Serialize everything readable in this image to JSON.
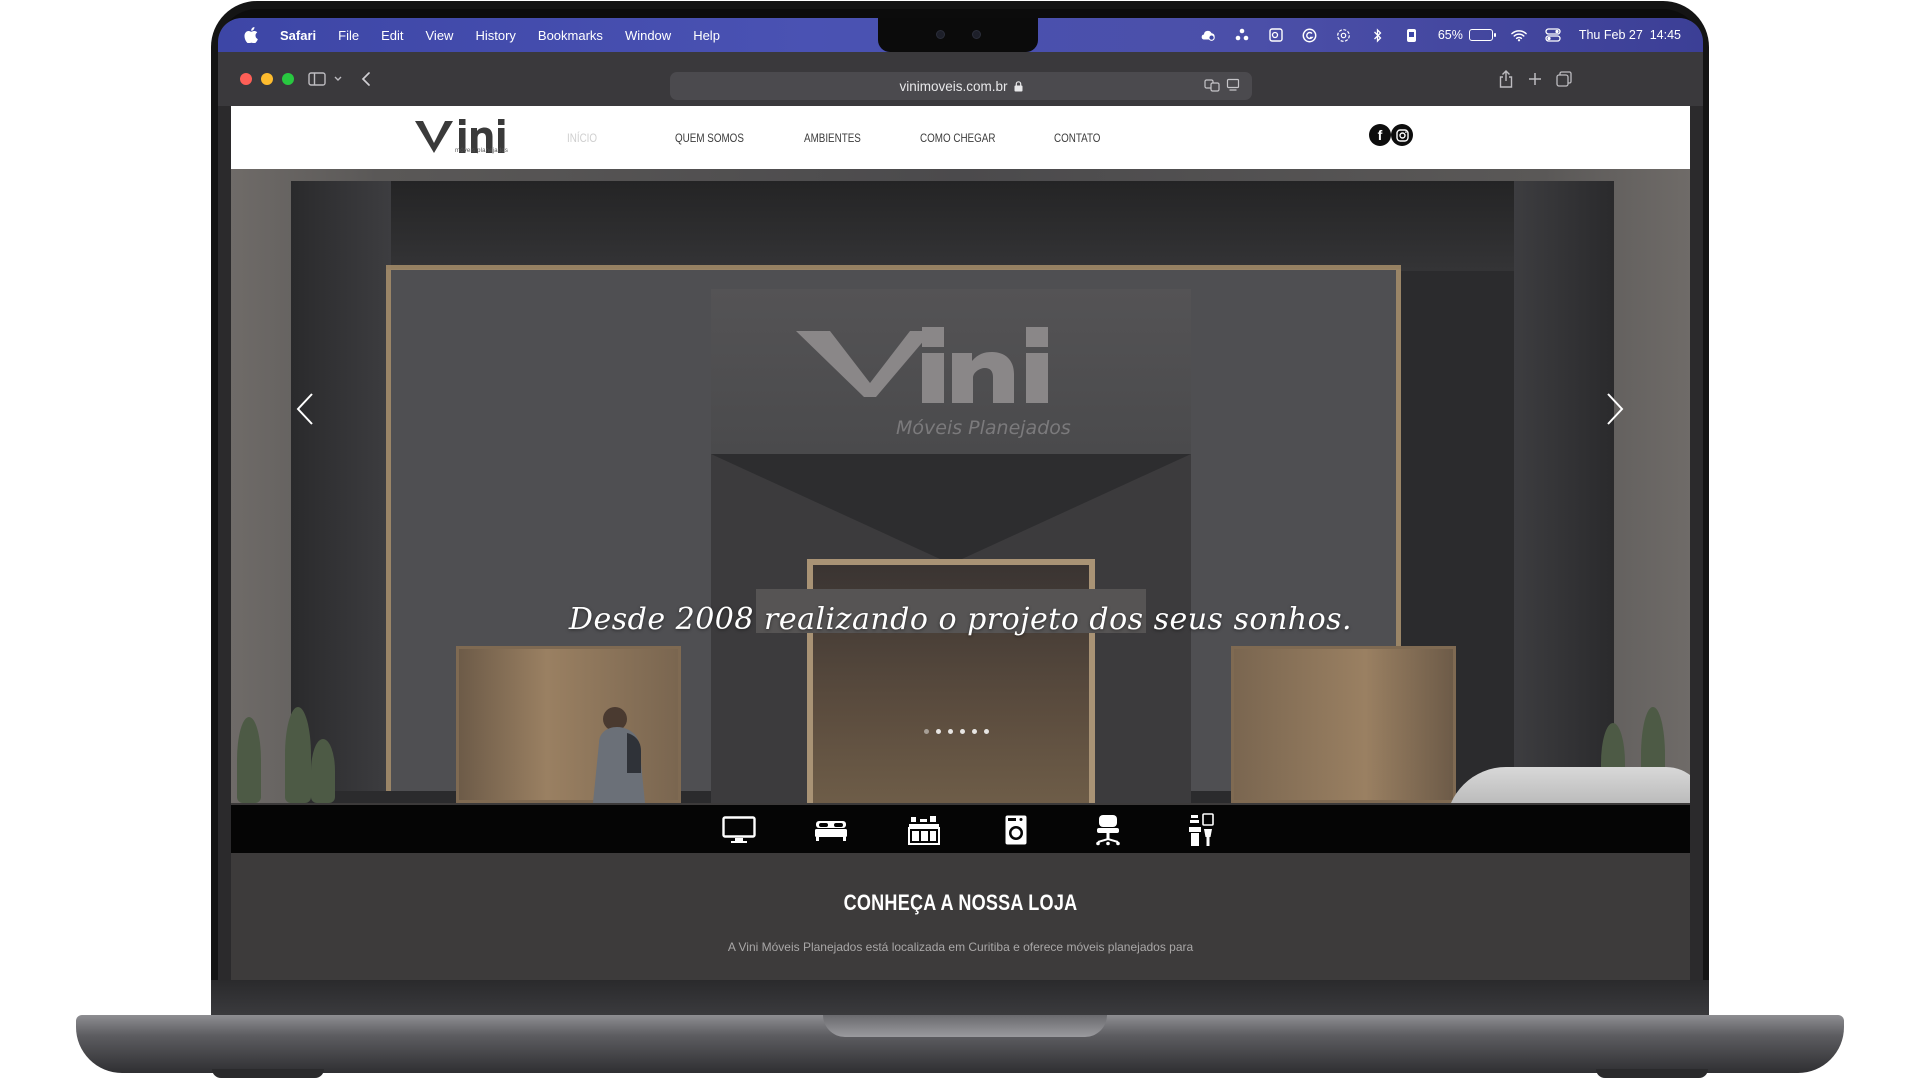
{
  "menubar": {
    "app": "Safari",
    "items": [
      "File",
      "Edit",
      "View",
      "History",
      "Bookmarks",
      "Window",
      "Help"
    ],
    "battery": "65%",
    "battery_level": 0.65,
    "datetime": "Thu Feb 27  14:45"
  },
  "browser": {
    "url": "vinimoveis.com.br"
  },
  "site": {
    "logo_text": "vini",
    "logo_sub": "móveis planejados",
    "nav": [
      "INÍCIO",
      "QUEM SOMOS",
      "AMBIENTES",
      "COMO CHEGAR",
      "CONTATO"
    ],
    "active_nav": "INÍCIO",
    "social": [
      "facebook-icon",
      "instagram-icon"
    ]
  },
  "hero": {
    "sign_text": "vini",
    "sign_sub": "Móveis Planejados",
    "caption": "Desde 2008 realizando o projeto dos seus sonhos.",
    "slides": 6,
    "active_slide": 1
  },
  "categories": [
    "tv-icon",
    "bed-icon",
    "kitchen-icon",
    "laundry-icon",
    "office-chair-icon",
    "bathroom-icon"
  ],
  "section": {
    "title": "CONHEÇA A NOSSA LOJA",
    "text": "A Vini Móveis Planejados está localizada em Curitiba e oferece móveis planejados para"
  }
}
